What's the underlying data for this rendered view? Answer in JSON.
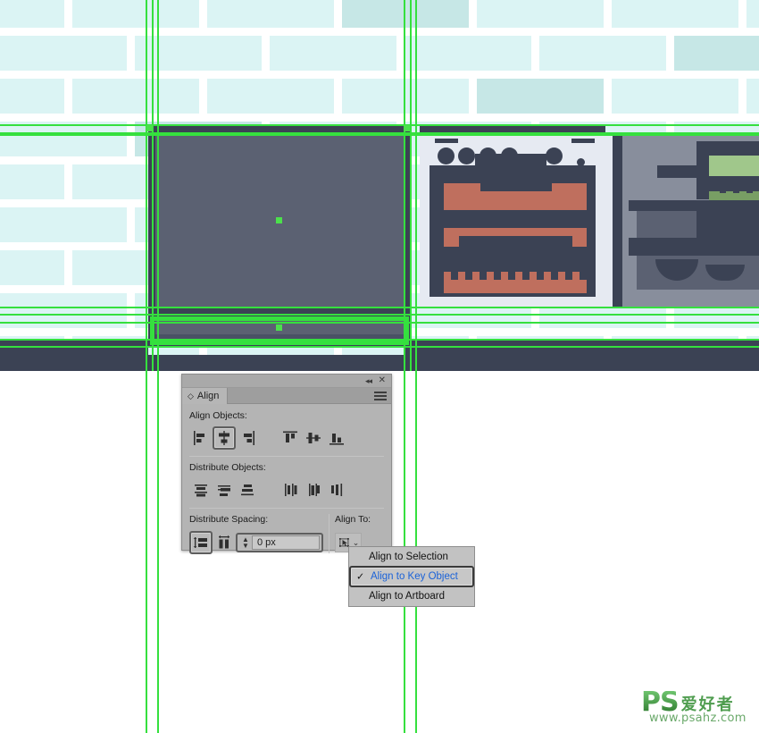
{
  "app": {
    "canvas_background": "#ffffff",
    "guide_color": "#35e03e",
    "tile_color": "#dbf4f4",
    "tile_accent_color": "#c6e7e6",
    "dark_color": "#3b4254",
    "panel_grey": "#5b6172",
    "rack_color": "#bf6f5e",
    "green_accent": "#a0c78b"
  },
  "align_panel": {
    "title": "Align",
    "collapse_icon": "double-chevron-left-icon",
    "close_icon": "close-icon",
    "menu_icon": "panel-menu-icon",
    "tab_icon": "diamond-icon",
    "sections": {
      "align_objects": {
        "label": "Align Objects:",
        "buttons": [
          {
            "name": "horizontal-align-left",
            "active": false
          },
          {
            "name": "horizontal-align-center",
            "active": true
          },
          {
            "name": "horizontal-align-right",
            "active": false
          },
          {
            "name": "vertical-align-top",
            "active": false
          },
          {
            "name": "vertical-align-center",
            "active": false
          },
          {
            "name": "vertical-align-bottom",
            "active": false
          }
        ]
      },
      "distribute_objects": {
        "label": "Distribute Objects:",
        "buttons": [
          {
            "name": "vertical-distribute-top",
            "active": false
          },
          {
            "name": "vertical-distribute-center",
            "active": false
          },
          {
            "name": "vertical-distribute-bottom",
            "active": false
          },
          {
            "name": "horizontal-distribute-left",
            "active": false
          },
          {
            "name": "horizontal-distribute-center",
            "active": false
          },
          {
            "name": "horizontal-distribute-right",
            "active": false
          }
        ]
      },
      "distribute_spacing": {
        "label": "Distribute Spacing:",
        "buttons": [
          {
            "name": "vertical-distribute-spacing",
            "active": true
          },
          {
            "name": "horizontal-distribute-spacing",
            "active": false
          }
        ],
        "value": "0 px",
        "stepper_up": "▲",
        "stepper_down": "▼"
      },
      "align_to": {
        "label": "Align To:",
        "button_icon": "align-to-key-object-icon",
        "chevron": "⌄"
      }
    }
  },
  "dropdown": {
    "items": [
      {
        "label": "Align to Selection",
        "selected": false,
        "checked": false
      },
      {
        "label": "Align to Key Object",
        "selected": true,
        "checked": true
      },
      {
        "label": "Align to Artboard",
        "selected": false,
        "checked": false
      }
    ],
    "check_glyph": "✓"
  },
  "watermark": {
    "logo": "PS",
    "chinese": "爱好者",
    "url": "www.psahz.com"
  },
  "artwork": {
    "description": "kitchen-illustration",
    "tiles_rows": 9,
    "selected_object": "large-grey-panel",
    "key_object": "bottom-bar"
  }
}
